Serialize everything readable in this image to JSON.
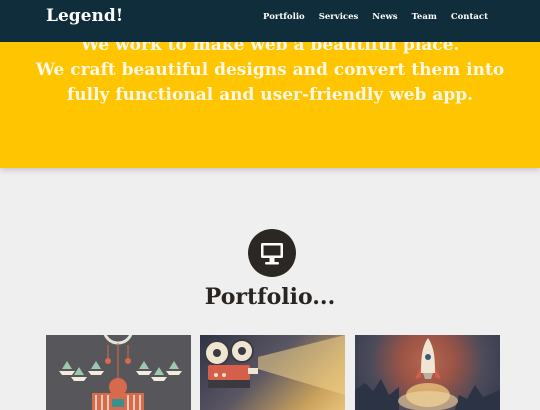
{
  "navbar": {
    "logo": "Legend!",
    "links": [
      "Portfolio",
      "Services",
      "News",
      "Team",
      "Contact"
    ]
  },
  "hero": {
    "lines": [
      "We work to make web a beautiful place.",
      "We craft beautiful designs and convert them into",
      "fully functional and user-friendly web app."
    ]
  },
  "portfolio": {
    "icon": "monitor-icon",
    "title": "Portfolio..."
  },
  "colors": {
    "navbar": "#0f2d3a",
    "hero": "#ffc500",
    "page_bg": "#efefef",
    "icon_circle": "#2b2722"
  }
}
